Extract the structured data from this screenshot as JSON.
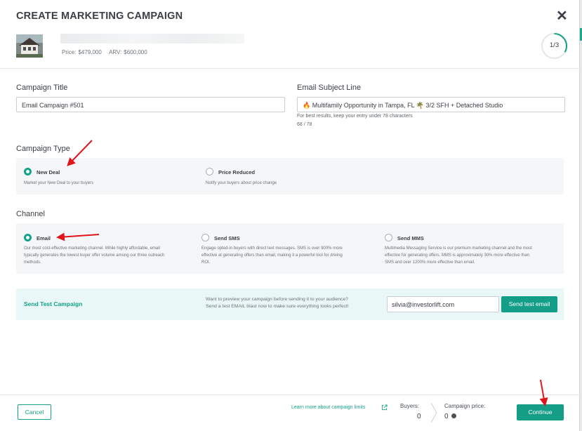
{
  "header": {
    "title": "CREATE MARKETING CAMPAIGN",
    "price_label": "Price:",
    "price_value": "$479,000",
    "arv_label": "ARV:",
    "arv_value": "$600,000",
    "step": "1/3",
    "step_progress": 0.333
  },
  "campaign_title": {
    "label": "Campaign Title",
    "value": "Email Campaign #501"
  },
  "subject_line": {
    "label": "Email Subject Line",
    "value": "🔥 Multifamily Opportunity in Tampa, FL 🌴 3/2 SFH + Detached Studio",
    "hint": "For best results, keep your entry under 78 characters",
    "counter": "68 / 78"
  },
  "campaign_type": {
    "label": "Campaign Type",
    "options": [
      {
        "title": "New Deal",
        "desc": "Market your New Deal to your buyers",
        "selected": true
      },
      {
        "title": "Price Reduced",
        "desc": "Notify your buyers about price change",
        "selected": false
      }
    ]
  },
  "channel": {
    "label": "Channel",
    "options": [
      {
        "title": "Email",
        "desc_lines": [
          "Our most cost-effective marketing channel. While highly affordable, email",
          "typically generates the lowest buyer offer volume among our three outreach",
          "methods."
        ],
        "selected": true
      },
      {
        "title": "Send SMS",
        "desc_lines": [
          "Engage opted-in buyers with direct text messages. SMS is over 900% more",
          "effective at generating offers than email, making it a powerful tool for driving",
          "ROI."
        ],
        "selected": false
      },
      {
        "title": "Send MMS",
        "desc_lines": [
          "Multimedia Messaging Service is our premium marketing channel and the most",
          "effective for generating offers. MMS is approximately 30% more effective than",
          "SMS and over 1200% more effective than email."
        ],
        "selected": false
      }
    ]
  },
  "test_campaign": {
    "link": "Send Test Campaign",
    "info_line1": "Want to preview your campaign before sending it to your audience?",
    "info_line2": "Send a test EMAIL blast now to make sure everything looks perfect!",
    "email_value": "silvia@investorlift.com",
    "button": "Send test email"
  },
  "footer": {
    "cancel": "Cancel",
    "learn_more": "Learn more about campaign limits",
    "buyers_label": "Buyers:",
    "buyers_value": "0",
    "price_label": "Campaign price:",
    "price_value": "0",
    "continue": "Continue"
  },
  "colors": {
    "accent": "#149e87",
    "annotation_arrow": "#e0141b"
  }
}
